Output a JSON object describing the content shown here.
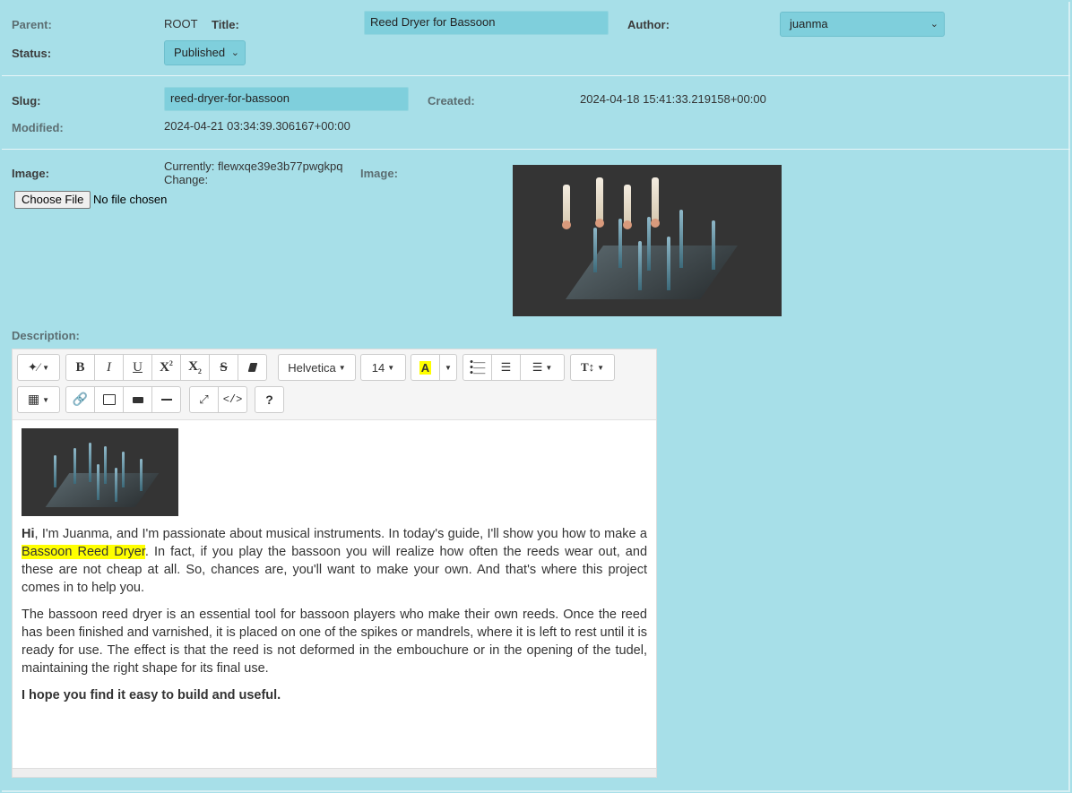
{
  "row1": {
    "parent_label": "Parent:",
    "parent_value": "ROOT",
    "title_label": "Title:",
    "title_value": "Reed Dryer for Bassoon",
    "author_label": "Author:",
    "author_value": "juanma",
    "status_label": "Status:",
    "status_value": "Published"
  },
  "row2": {
    "slug_label": "Slug:",
    "slug_value": "reed-dryer-for-bassoon",
    "created_label": "Created:",
    "created_value": "2024-04-18 15:41:33.219158+00:00",
    "modified_label": "Modified:",
    "modified_value": "2024-04-21 03:34:39.306167+00:00"
  },
  "row3": {
    "image_label": "Image:",
    "currently_text": "Currently: flewxqe39e3b77pwgkpq",
    "change_text": "Change:",
    "choose_file": "Choose File",
    "no_file": "No file chosen",
    "image_preview_label": "Image:"
  },
  "description": {
    "label": "Description:",
    "toolbar": {
      "font_family": "Helvetica",
      "font_size": "14"
    },
    "p1_bold": "Hi",
    "p1_a": ", I'm Juanma, and I'm passionate about musical instruments. In today's guide, I'll show you how to make a ",
    "p1_highlight": "Bassoon Reed Dryer",
    "p1_b": ". In fact, if you play the bassoon you will realize how often the reeds wear out, and these are not cheap at all. So, chances are, you'll want to make your own. And that's where this project comes in to help you.",
    "p2": "The bassoon reed dryer is an essential tool for bassoon players who make their own reeds. Once the reed has been finished and varnished, it is placed on one of the spikes or mandrels, where it is left to rest until it is ready for use. The effect is that the reed is not deformed in the embouchure or in the opening of the tudel, maintaining the right shape for its final use.",
    "p3": "I hope you find it easy to build and useful."
  },
  "colors": {
    "background": "#a7dfe8",
    "input": "#7fcfdc",
    "highlight": "#ffff00"
  }
}
